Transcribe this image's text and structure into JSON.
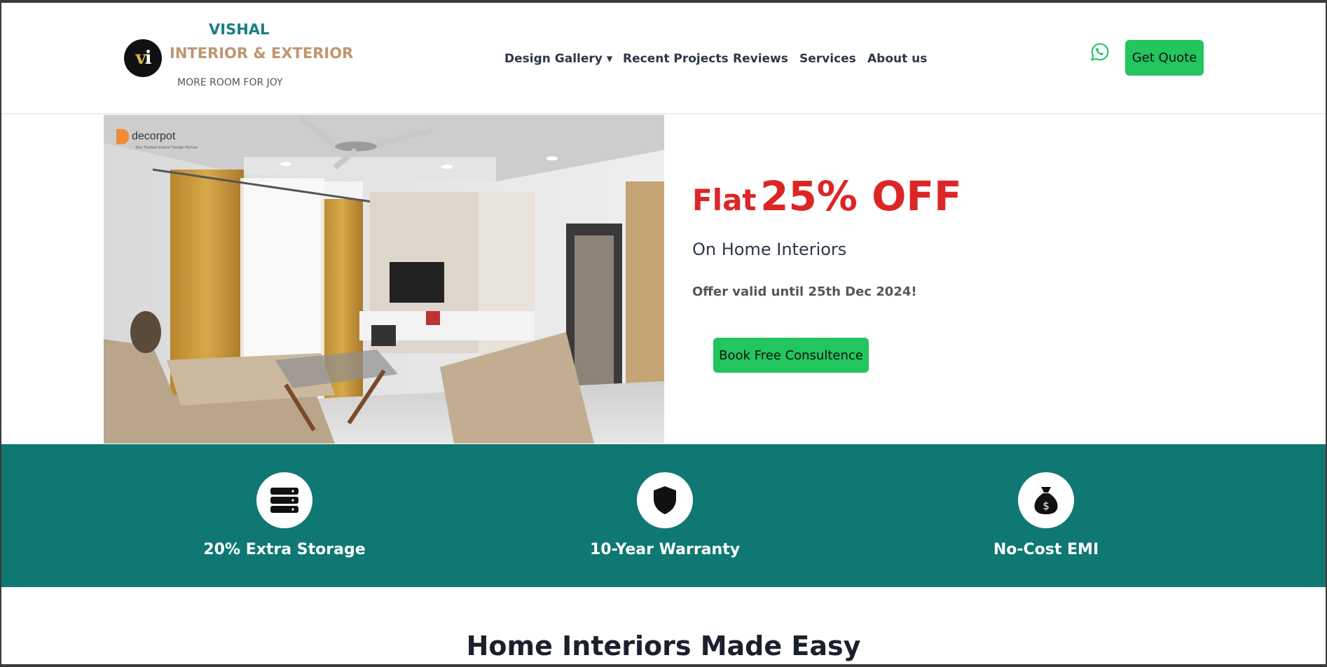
{
  "brand": {
    "name_top": "VISHAL",
    "name_mid": "INTERIOR & EXTERIOR",
    "tagline": "MORE ROOM FOR JOY",
    "logo_letters": "vi"
  },
  "nav": {
    "items": [
      {
        "label": "Design Gallery ▾"
      },
      {
        "label": "Recent Projects"
      },
      {
        "label": "Reviews"
      },
      {
        "label": "Services"
      },
      {
        "label": "About us"
      }
    ],
    "quote_label": "Get Quote",
    "whatsapp_icon": "whatsapp-icon"
  },
  "hero": {
    "image_brand": "decorpot",
    "image_tagline": "Your Trusted Interior Design Partner",
    "offer_prefix": "Flat",
    "offer_value": "25% OFF",
    "offer_subtitle": "On Home Interiors",
    "offer_validity": "Offer valid until 25th Dec 2024!",
    "cta_label": "Book Free Consultence"
  },
  "features": [
    {
      "label": "20% Extra Storage",
      "icon": "storage-icon"
    },
    {
      "label": "10-Year Warranty",
      "icon": "shield-icon"
    },
    {
      "label": "No-Cost EMI",
      "icon": "money-bag-icon"
    }
  ],
  "section": {
    "title": "Home Interiors Made Easy"
  },
  "colors": {
    "brand_teal": "#0f7872",
    "accent_green": "#22c55e",
    "offer_red": "#dc2626",
    "brand_gold": "#bd9670"
  }
}
